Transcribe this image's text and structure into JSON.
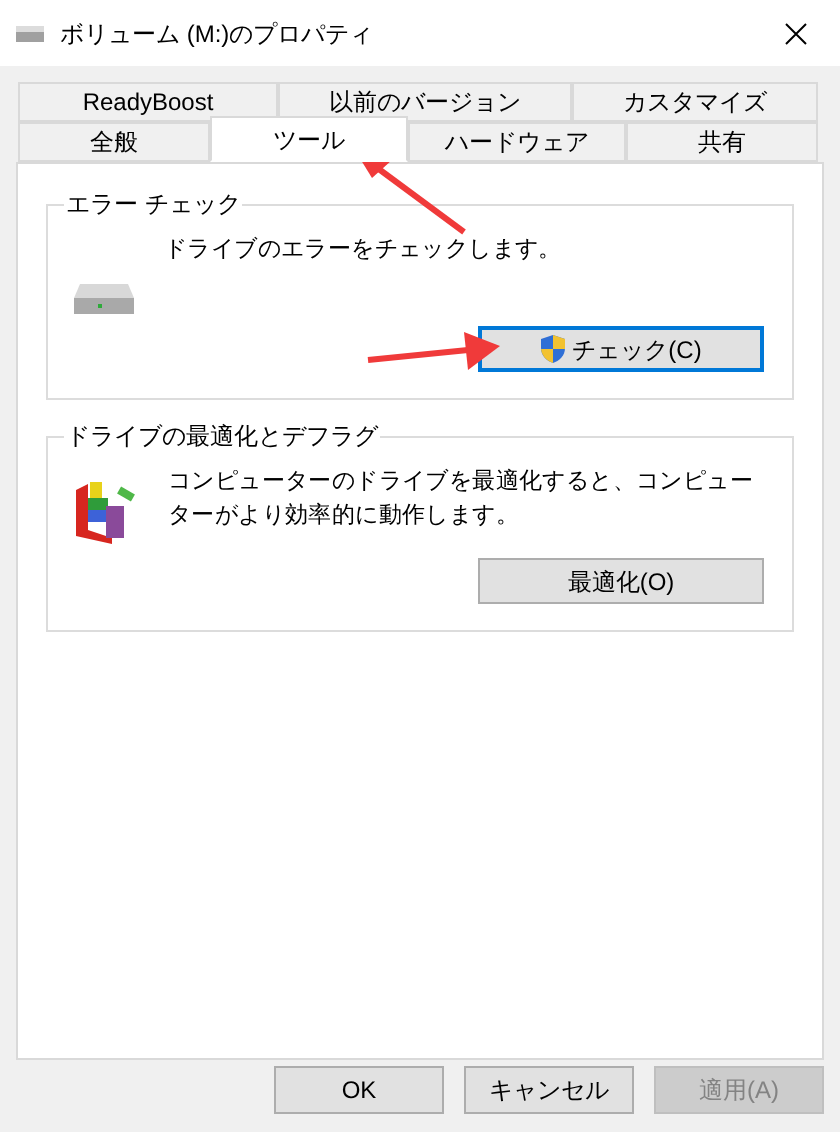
{
  "window": {
    "title": "ボリューム (M:)のプロパティ"
  },
  "tab_rows": [
    [
      {
        "label": "ReadyBoost",
        "selected": false
      },
      {
        "label": "以前のバージョン",
        "selected": false
      },
      {
        "label": "カスタマイズ",
        "selected": false
      }
    ],
    [
      {
        "label": "全般",
        "selected": false
      },
      {
        "label": "ツール",
        "selected": true
      },
      {
        "label": "ハードウェア",
        "selected": false
      },
      {
        "label": "共有",
        "selected": false
      }
    ]
  ],
  "groups": [
    {
      "kind": "drive",
      "title": "エラー チェック",
      "description": "ドライブのエラーをチェックします。",
      "button": {
        "label": "チェック(C)",
        "shield": true,
        "focused": true
      }
    },
    {
      "kind": "defrag",
      "title": "ドライブの最適化とデフラグ",
      "description": "コンピューターのドライブを最適化すると、コンピューターがより効率的に動作します。",
      "button": {
        "label": "最適化(O)",
        "shield": false,
        "focused": false
      }
    }
  ],
  "buttons": [
    {
      "label": "OK",
      "disabled": false
    },
    {
      "label": "キャンセル",
      "disabled": false
    },
    {
      "label": "適用(A)",
      "disabled": true
    }
  ]
}
